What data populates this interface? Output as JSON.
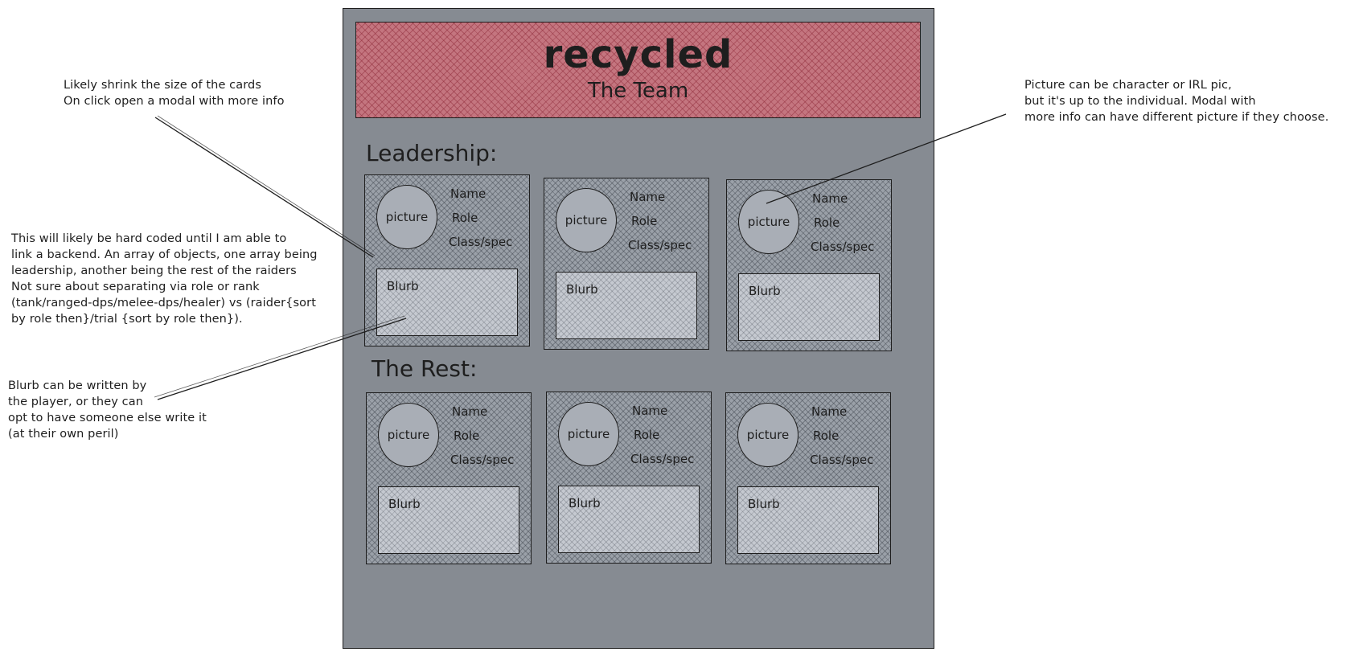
{
  "header": {
    "title": "recycled",
    "subtitle": "The Team"
  },
  "sections": {
    "leadership": "Leadership:",
    "rest": "The Rest:"
  },
  "card": {
    "picture": "picture",
    "name": "Name",
    "role": "Role",
    "class_spec": "Class/spec",
    "blurb": "Blurb"
  },
  "notes": {
    "cards_note": "Likely shrink the size of the cards\nOn click open a modal with more info",
    "picture_note": "Picture can be character or IRL pic,\nbut it's up to the individual. Modal with\nmore info can have different picture if they choose.",
    "data_note": "This will likely be hard coded until I am able to\nlink a backend. An array of objects, one array being\nleadership, another being the rest of the raiders\nNot sure about separating via role or rank\n(tank/ranged-dps/melee-dps/healer) vs (raider{sort\nby role then}/trial {sort by role then}).",
    "blurb_note": "Blurb can be written by\nthe player, or they can\nopt to have someone else write it\n(at their own peril)"
  },
  "colors": {
    "frame": "#868b92",
    "header": "#c4757f",
    "card": "#9aa0a8",
    "blurb": "#c5c9d0",
    "stroke": "#1e1e1e"
  }
}
